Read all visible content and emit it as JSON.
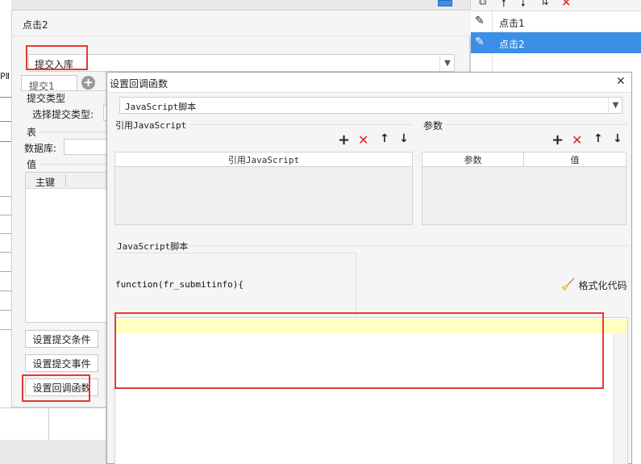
{
  "bg_dialog": {
    "title": "点击2",
    "submit_dropdown_value": "提交入库",
    "tab_label": "提交1",
    "submit_type_group": "提交类型",
    "select_type_label": "选择提交类型:",
    "table_group": "表",
    "database_label": "数据库:",
    "value_group": "值",
    "primary_key_header": "主键",
    "left_clip_text": "PⅡ",
    "btn_set_condition": "设置提交条件",
    "btn_set_event": "设置提交事件",
    "btn_set_callback": "设置回调函数"
  },
  "right_panel": {
    "items": [
      {
        "label": "点击1",
        "selected": false
      },
      {
        "label": "点击2",
        "selected": true
      }
    ]
  },
  "dialog": {
    "title": "设置回调函数",
    "type_dropdown_value": "JavaScript脚本",
    "ref_js_group": "引用JavaScript",
    "ref_js_column": "引用JavaScript",
    "params_group": "参数",
    "params_columns": [
      "参数",
      "值"
    ],
    "script_group": "JavaScript脚本",
    "function_signature": "function(fr_submitinfo){",
    "format_code_label": "格式化代码"
  },
  "colors": {
    "accent": "#3c8fe6",
    "highlight_red": "#e53935",
    "delete_red": "#e02020",
    "line_highlight": "#ffffc0"
  }
}
